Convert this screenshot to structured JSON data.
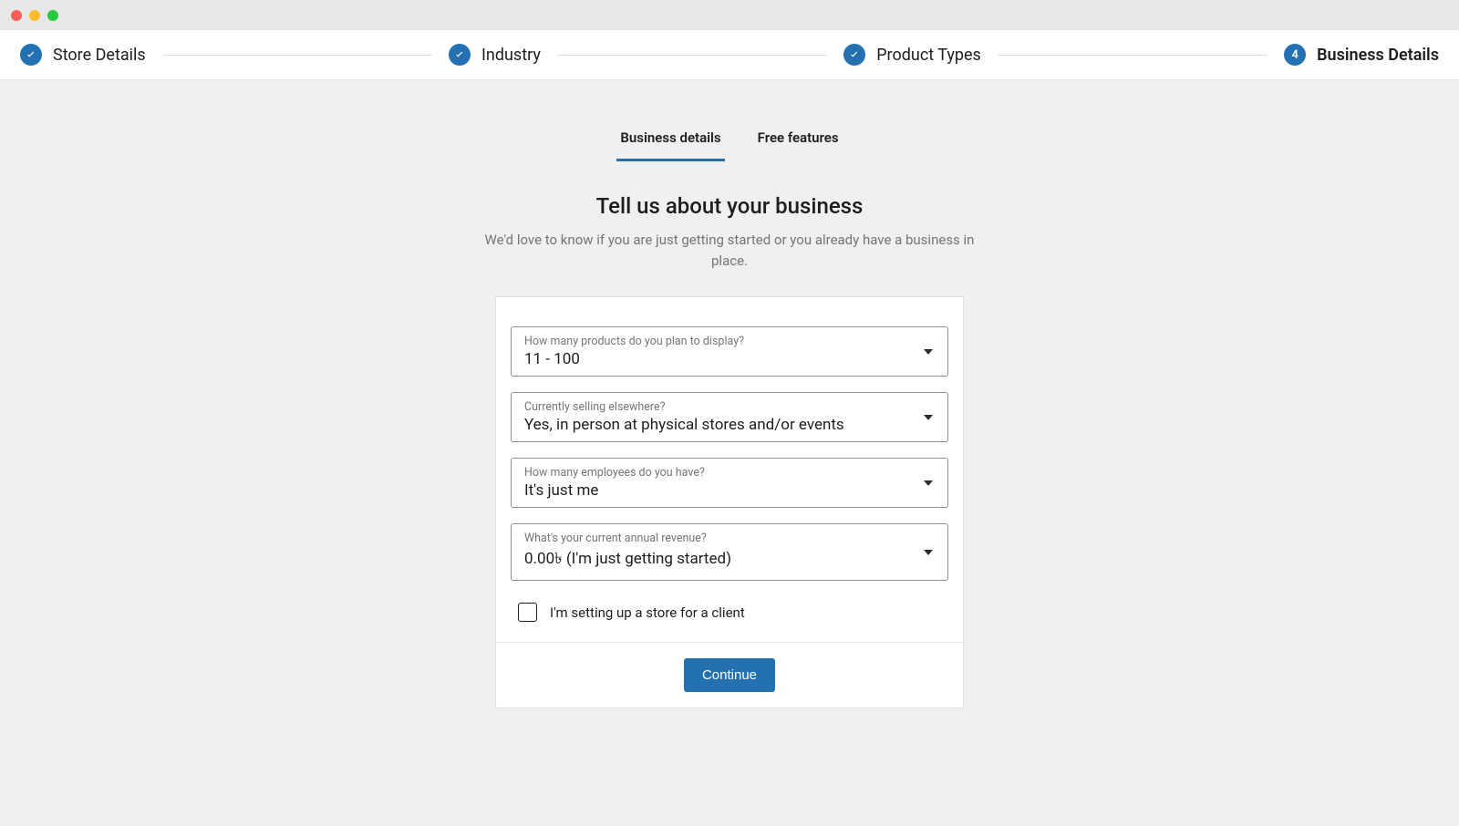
{
  "stepper": {
    "steps": [
      {
        "label": "Store Details",
        "state": "done"
      },
      {
        "label": "Industry",
        "state": "done"
      },
      {
        "label": "Product Types",
        "state": "done"
      },
      {
        "label": "Business Details",
        "state": "current",
        "number": "4"
      }
    ]
  },
  "tabs": {
    "items": [
      {
        "label": "Business details",
        "active": true
      },
      {
        "label": "Free features",
        "active": false
      }
    ]
  },
  "heading": {
    "title": "Tell us about your business",
    "subtitle": "We'd love to know if you are just getting started or you already have a business in place."
  },
  "fields": {
    "products": {
      "label": "How many products do you plan to display?",
      "value": "11 - 100"
    },
    "selling": {
      "label": "Currently selling elsewhere?",
      "value": "Yes, in person at physical stores and/or events"
    },
    "employees": {
      "label": "How many employees do you have?",
      "value": "It's just me"
    },
    "revenue": {
      "label": "What's your current annual revenue?",
      "value": "0.00৳  (I'm just getting started)"
    }
  },
  "checkbox": {
    "label": "I'm setting up a store for a client",
    "checked": false
  },
  "buttons": {
    "continue": "Continue"
  }
}
